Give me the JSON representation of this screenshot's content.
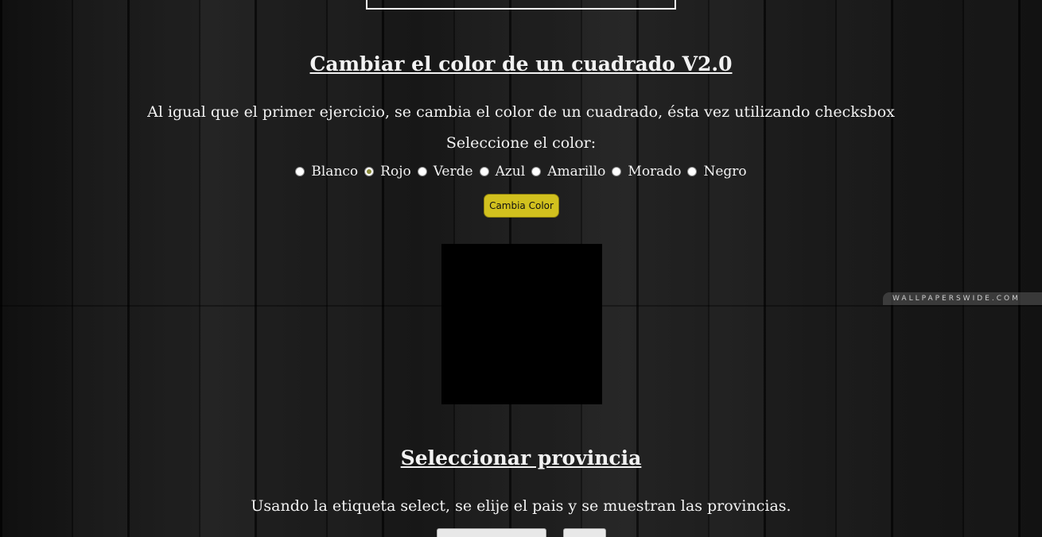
{
  "section_color": {
    "title": "Cambiar el color de un cuadrado V2.0",
    "description": "Al igual que el primer ejercicio, se cambia el color de un cuadrado, ésta vez utilizando checksbox",
    "prompt": "Seleccione el color:",
    "options": [
      {
        "label": "Blanco",
        "checked": false
      },
      {
        "label": "Rojo",
        "checked": true
      },
      {
        "label": "Verde",
        "checked": false
      },
      {
        "label": "Azul",
        "checked": false
      },
      {
        "label": "Amarillo",
        "checked": false
      },
      {
        "label": "Morado",
        "checked": false
      },
      {
        "label": "Negro",
        "checked": false
      }
    ],
    "button_label": "Cambia Color",
    "square_color": "#000000",
    "button_color": "#d2c11e"
  },
  "section_province": {
    "title": "Seleccionar provincia",
    "description": "Usando la etiqueta select, se elije el pais y se muestran las provincias."
  },
  "background": {
    "watermark": "WALLPAPERSWIDE.COM"
  }
}
